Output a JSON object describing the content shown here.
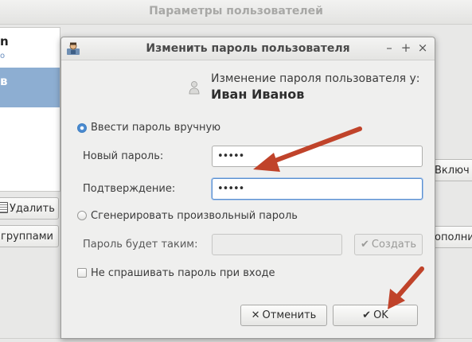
{
  "background": {
    "title": "Параметры пользователей",
    "list_item_1": "n",
    "list_item_1_sub": "о",
    "list_item_selected": "в",
    "delete_label": "Удалить",
    "groups_label": "группами",
    "enable_label": "Включ",
    "more_label": "ополни"
  },
  "dialog": {
    "title": "Изменить пароль пользователя",
    "header_line1": "Изменение пароля пользователя у:",
    "header_user": "Иван Иванов",
    "radio_manual_label": "Ввести пароль вручную",
    "new_password_label": "Новый пароль:",
    "new_password_value": "•••••",
    "confirm_label": "Подтверждение:",
    "confirm_value": "•••••",
    "radio_generate_label": "Сгенерировать произвольный пароль",
    "generated_label": "Пароль будет таким:",
    "generated_value": "",
    "create_label": "Создать",
    "no_ask_label": "Не спрашивать пароль при входе",
    "cancel_label": "Отменить",
    "ok_label": "OK",
    "radio_manual_selected": true,
    "no_ask_checked": false
  },
  "colors": {
    "annotation_arrow": "#c0432a",
    "selection": "#8daed2",
    "focus": "#5a8fd0"
  },
  "icons": [
    "user-icon",
    "app-icon",
    "minimize-icon",
    "maximize-icon",
    "close-icon",
    "cancel-x-icon",
    "check-icon",
    "trash-icon"
  ]
}
